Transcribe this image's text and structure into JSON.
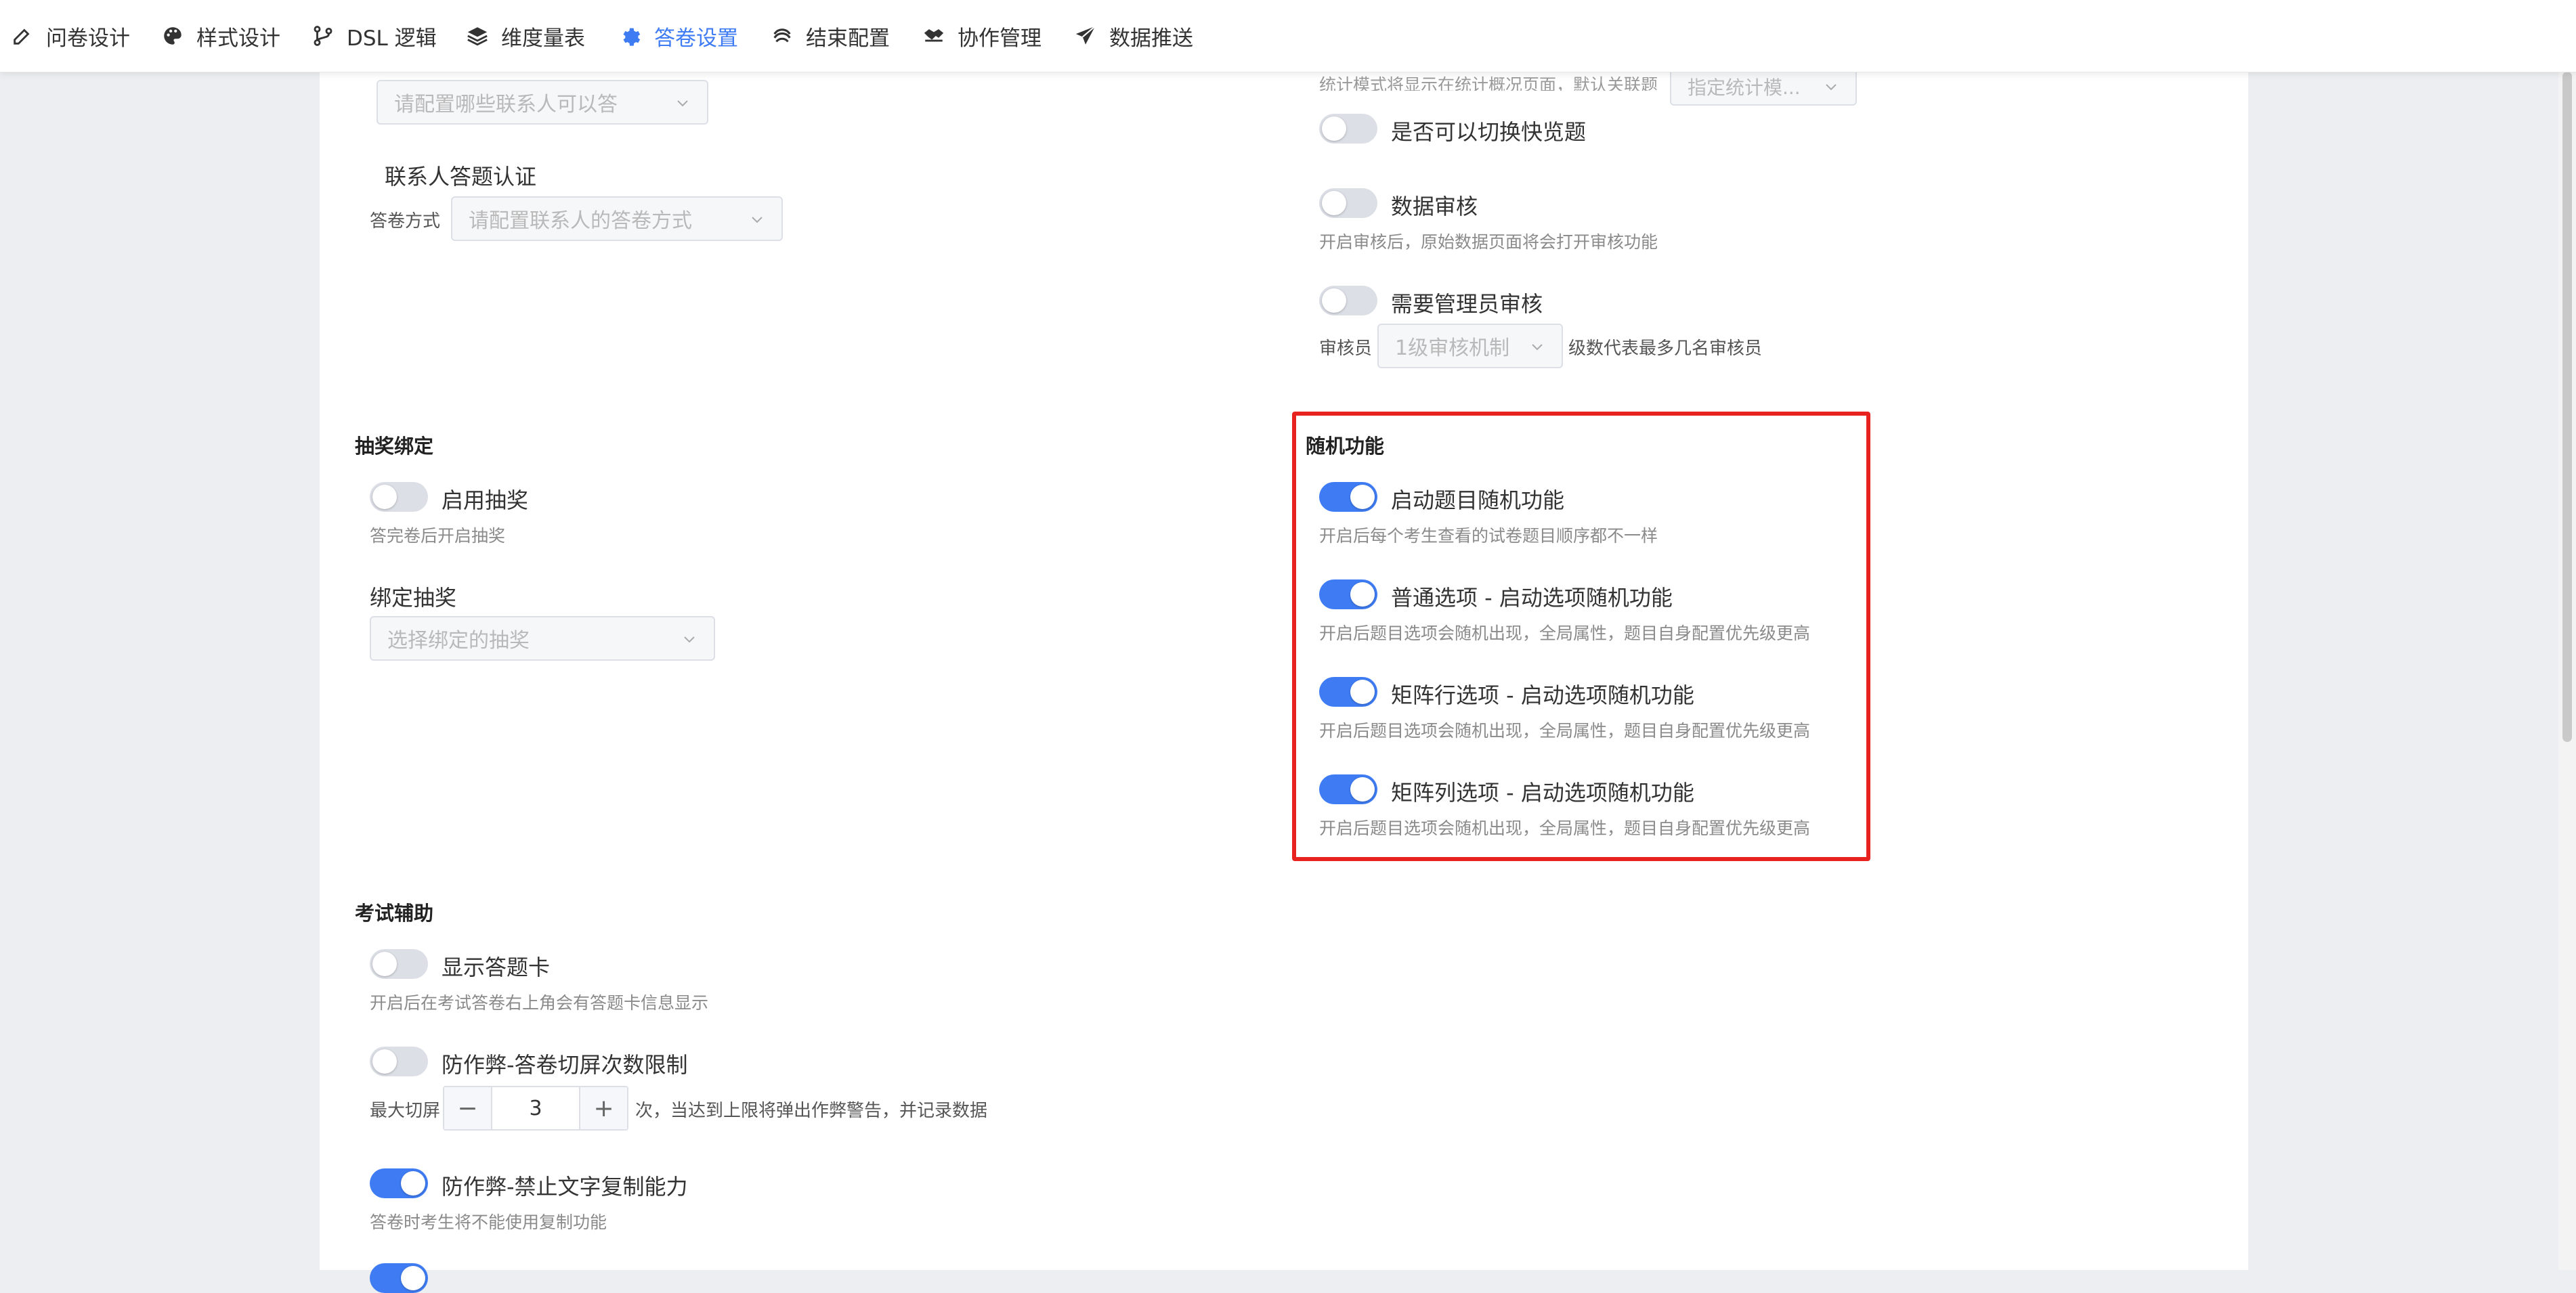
{
  "nav": {
    "items": [
      {
        "label": "问卷设计",
        "icon": "edit-icon"
      },
      {
        "label": "样式设计",
        "icon": "palette-icon"
      },
      {
        "label": "DSL 逻辑",
        "icon": "code-branch-icon"
      },
      {
        "label": "维度量表",
        "icon": "layers-icon"
      },
      {
        "label": "答卷设置",
        "icon": "gear-icon",
        "active": true
      },
      {
        "label": "结束配置",
        "icon": "stack-icon"
      },
      {
        "label": "协作管理",
        "icon": "handshake-icon"
      },
      {
        "label": "数据推送",
        "icon": "send-icon"
      }
    ],
    "active_color": "#3f7cf3"
  },
  "left": {
    "contacts_select_placeholder": "请配置哪些联系人可以答",
    "contact_auth_title": "联系人答题认证",
    "answer_mode_label": "答卷方式",
    "answer_mode_placeholder": "请配置联系人的答卷方式",
    "lottery": {
      "title": "抽奖绑定",
      "enable_label": "启用抽奖",
      "enable_on": false,
      "enable_hint": "答完卷后开启抽奖",
      "bind_label": "绑定抽奖",
      "bind_placeholder": "选择绑定的抽奖"
    },
    "exam": {
      "title": "考试辅助",
      "answer_card_label": "显示答题卡",
      "answer_card_on": false,
      "answer_card_hint": "开启后在考试答卷右上角会有答题卡信息显示",
      "switch_limit_label": "防作弊-答卷切屏次数限制",
      "switch_limit_on": false,
      "max_switch_label": "最大切屏",
      "max_switch_value": "3",
      "max_switch_suffix": "次，当达到上限将弹出作弊警告，并记录数据",
      "no_copy_label": "防作弊-禁止文字复制能力",
      "no_copy_on": true,
      "no_copy_hint": "答卷时考生将不能使用复制功能"
    }
  },
  "right": {
    "truncated_text": "统计模式将显示在统计概况页面，默认关联题",
    "truncated_select": "指定统计模...",
    "quick_switch_label": "是否可以切换快览题",
    "quick_switch_on": false,
    "data_audit_label": "数据审核",
    "data_audit_on": false,
    "data_audit_hint": "开启审核后，原始数据页面将会打开审核功能",
    "admin_audit_label": "需要管理员审核",
    "admin_audit_on": false,
    "auditor_label": "审核员",
    "auditor_select": "1级审核机制",
    "auditor_suffix": "级数代表最多几名审核员",
    "random": {
      "title": "随机功能",
      "items": [
        {
          "label": "启动题目随机功能",
          "on": true,
          "hint": "开启后每个考生查看的试卷题目顺序都不一样"
        },
        {
          "label": "普通选项 - 启动选项随机功能",
          "on": true,
          "hint": "开启后题目选项会随机出现，全局属性，题目自身配置优先级更高"
        },
        {
          "label": "矩阵行选项 - 启动选项随机功能",
          "on": true,
          "hint": "开启后题目选项会随机出现，全局属性，题目自身配置优先级更高"
        },
        {
          "label": "矩阵列选项 - 启动选项随机功能",
          "on": true,
          "hint": "开启后题目选项会随机出现，全局属性，题目自身配置优先级更高"
        }
      ]
    }
  },
  "colors": {
    "highlight": "#e8231f",
    "switch_on": "#3f7cf3",
    "switch_off": "#dcdfe6"
  }
}
